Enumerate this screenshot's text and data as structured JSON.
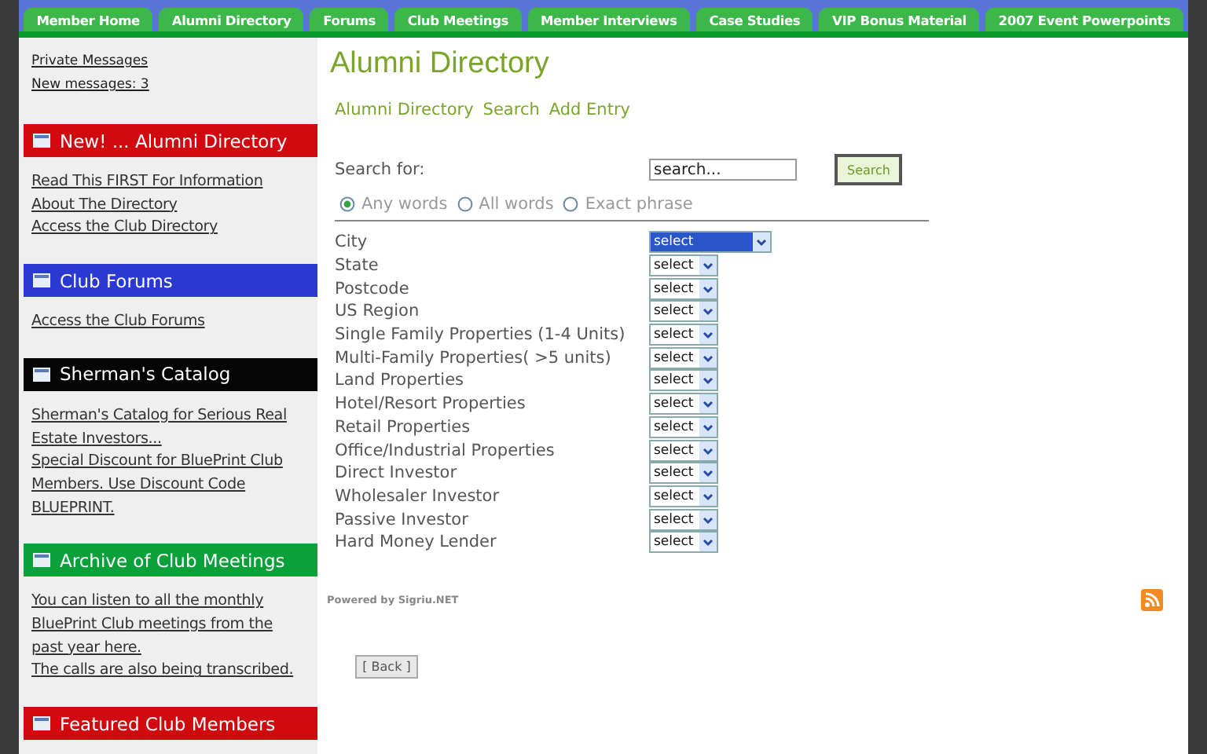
{
  "tabs": [
    {
      "label": "Member Home"
    },
    {
      "label": "Alumni Directory"
    },
    {
      "label": "Forums"
    },
    {
      "label": "Club Meetings"
    },
    {
      "label": "Member Interviews"
    },
    {
      "label": "Case Studies"
    },
    {
      "label": "VIP Bonus Material"
    },
    {
      "label": "2007 Event Powerpoints"
    }
  ],
  "sidebar": {
    "messages": [
      "Private Messages",
      "New messages: 3"
    ],
    "sections": [
      {
        "title": "New! ... Alumni Directory",
        "color": "#d10a10",
        "links": [
          "Read This FIRST For Information About The Directory",
          "Access the Club Directory"
        ]
      },
      {
        "title": "Club Forums",
        "color": "#2a3ad0",
        "links": [
          "Access the Club Forums"
        ]
      },
      {
        "title": "Sherman's Catalog",
        "color": "#050505",
        "links": [
          "Sherman's Catalog for Serious Real Estate Investors...",
          "Special Discount for BluePrint Club Members. Use Discount Code BLUEPRINT."
        ]
      },
      {
        "title": "Archive of Club Meetings",
        "color": "#0aa03a",
        "links": [
          "You can listen to all the monthly BluePrint Club meetings from the past year here.",
          "The calls are also being transcribed."
        ]
      },
      {
        "title": "Featured Club Members",
        "color": "#d10a10"
      }
    ]
  },
  "main": {
    "title": "Alumni Directory",
    "nav": [
      "Alumni Directory",
      "Search",
      "Add Entry"
    ],
    "search_label": "Search for:",
    "search_value": "search...",
    "search_button": "Search",
    "modes": [
      {
        "label": "Any words",
        "selected": true
      },
      {
        "label": "All words",
        "selected": false
      },
      {
        "label": "Exact phrase",
        "selected": false
      }
    ],
    "filters": [
      {
        "label": "City",
        "value": "select",
        "focused": true
      },
      {
        "label": "State",
        "value": "select",
        "focused": false
      },
      {
        "label": "Postcode",
        "value": "select",
        "focused": false
      },
      {
        "label": "US Region",
        "value": "select",
        "focused": false
      },
      {
        "label": "Single Family Properties (1-4 Units)",
        "value": "select",
        "focused": false
      },
      {
        "label": "Multi-Family Properties( >5 units)",
        "value": "select",
        "focused": false
      },
      {
        "label": "Land Properties",
        "value": "select",
        "focused": false
      },
      {
        "label": "Hotel/Resort Properties",
        "value": "select",
        "focused": false
      },
      {
        "label": "Retail Properties",
        "value": "select",
        "focused": false
      },
      {
        "label": "Office/Industrial Properties",
        "value": "select",
        "focused": false
      },
      {
        "label": "Direct Investor",
        "value": "select",
        "focused": false
      },
      {
        "label": "Wholesaler Investor",
        "value": "select",
        "focused": false
      },
      {
        "label": "Passive Investor",
        "value": "select",
        "focused": false
      },
      {
        "label": "Hard Money Lender",
        "value": "select",
        "focused": false
      }
    ],
    "powered": "Powered by Sigriu.NET",
    "back": "[ Back ]"
  }
}
